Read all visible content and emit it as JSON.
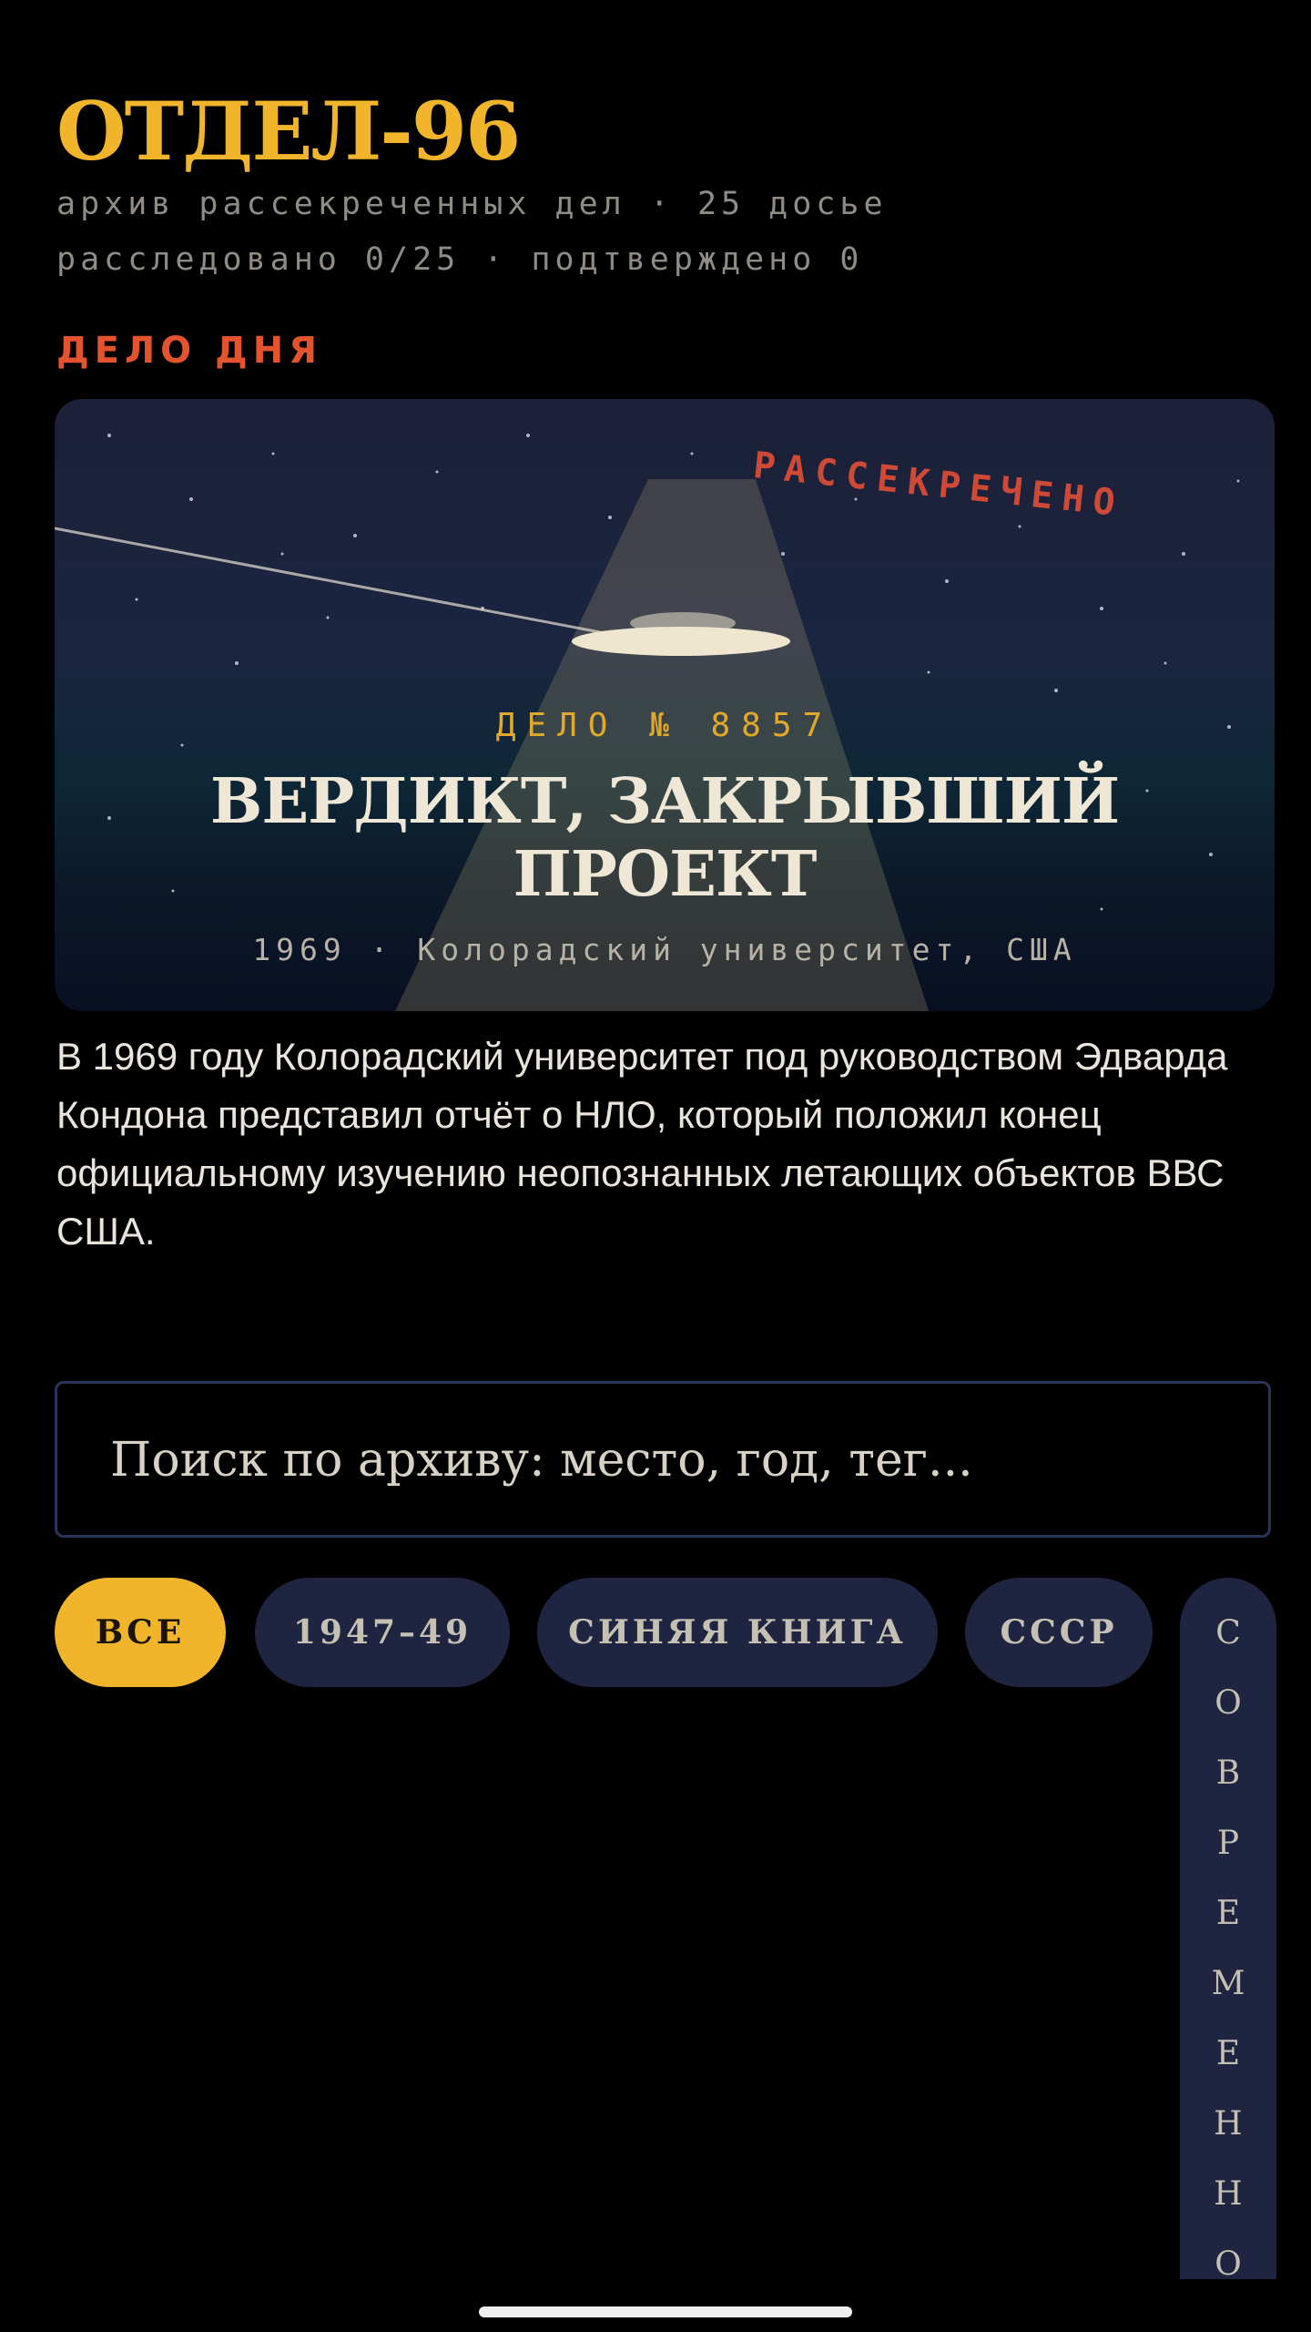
{
  "header": {
    "title": "ОТДЕЛ-96",
    "subtitle": "архив рассекреченных дел · 25 досье",
    "progress": "расследовано 0/25 · подтверждено 0"
  },
  "case_of_day": {
    "section_label": "ДЕЛО ДНЯ",
    "stamp": "РАССЕКРЕЧЕНО",
    "case_number": "ДЕЛО № 8857",
    "title": "ВЕРДИКТ, ЗАКРЫВШИЙ ПРОЕКТ",
    "meta": "1969 · Колорадский университет, США",
    "description": "В 1969 году Колорадский университет под руководством Эдварда Кондона представил отчёт о НЛО, который положил конец официальному изучению неопознанных летающих объектов ВВС США."
  },
  "search": {
    "placeholder": "Поиск по архиву: место, год, тег..."
  },
  "filters": {
    "active": "ВСЕ",
    "items": [
      "ВСЕ",
      "1947–49",
      "СИНЯЯ КНИГА",
      "СССР",
      "СОВРЕМЕННО"
    ]
  },
  "colors": {
    "accent": "#f1b52c",
    "stamp": "#cf4a36",
    "chip_bg": "#1f2440",
    "background": "#000000"
  },
  "icons": {
    "hero_illustration": "ufo-icon"
  }
}
